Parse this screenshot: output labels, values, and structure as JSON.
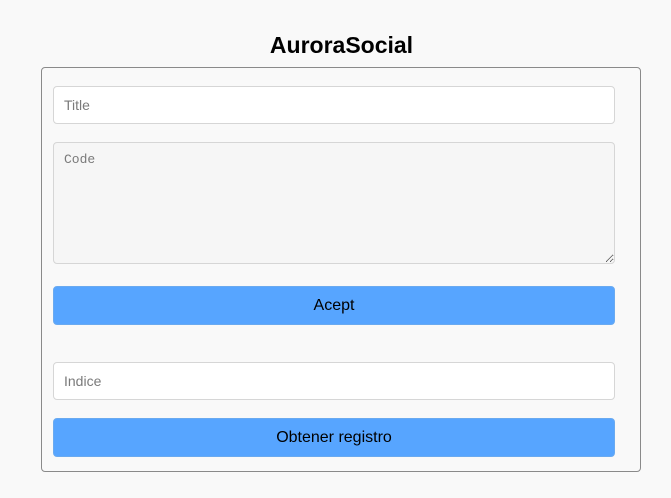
{
  "app": {
    "title": "AuroraSocial"
  },
  "form": {
    "title_placeholder": "Title",
    "title_value": "",
    "code_placeholder": "Code",
    "code_value": "",
    "accept_label": "Acept",
    "index_placeholder": "Indice",
    "index_value": "",
    "fetch_label": "Obtener registro"
  },
  "colors": {
    "background": "#f9f9f9",
    "button": "#57a5ff",
    "card_border": "#8a8a8a",
    "code_field_bg": "#f6f6f6"
  }
}
